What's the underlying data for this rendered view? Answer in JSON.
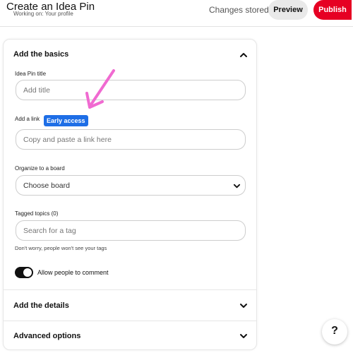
{
  "header": {
    "title": "Create an Idea Pin",
    "subtitle": "Working on: Your profile",
    "status": "Changes stored!",
    "preview_label": "Preview",
    "publish_label": "Publish"
  },
  "basics": {
    "section_title": "Add the basics",
    "expanded": true,
    "title_label": "Idea Pin title",
    "title_placeholder": "Add title",
    "link_label": "Add a link",
    "early_access_badge": "Early access",
    "link_placeholder": "Copy and paste a link here",
    "board_label": "Organize to a board",
    "board_value": "Choose board",
    "topics_label": "Tagged topics (0)",
    "topics_placeholder": "Search for a tag",
    "topics_hint": "Don't worry, people won't see your tags",
    "comment_toggle_label": "Allow people to comment",
    "comment_toggle_on": true
  },
  "details": {
    "section_title": "Add the details",
    "expanded": false
  },
  "advanced": {
    "section_title": "Advanced options",
    "expanded": false
  },
  "help": {
    "glyph": "?"
  },
  "colors": {
    "accent": "#e60023",
    "badge": "#1e6ee6",
    "annotation_arrow": "#f06ad1"
  },
  "icons": {
    "collapse": "chevron-up-icon",
    "expand": "chevron-down-icon",
    "select": "chevron-down-icon",
    "help": "question-mark-icon"
  }
}
